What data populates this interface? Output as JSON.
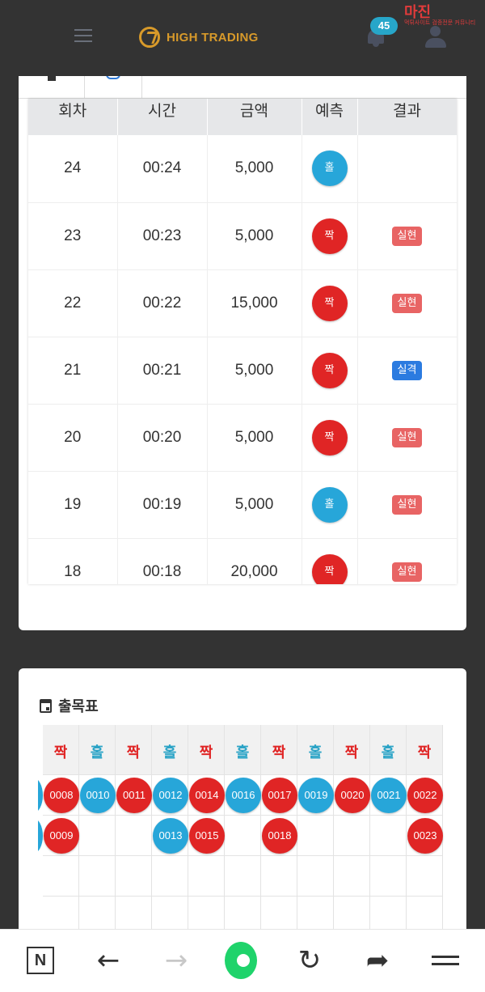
{
  "header": {
    "logo_text": "HIGH TRADING",
    "notification_count": "45",
    "watermark_main": "마진",
    "watermark_sub": "먹튀사이트 검증전문 커뮤니티"
  },
  "history_table": {
    "columns": [
      "회차",
      "시간",
      "금액",
      "예측",
      "결과"
    ],
    "rows": [
      {
        "round": "24",
        "time": "00:24",
        "amount": "5,000",
        "pick": "홀",
        "pick_type": "odd",
        "result": ""
      },
      {
        "round": "23",
        "time": "00:23",
        "amount": "5,000",
        "pick": "짝",
        "pick_type": "even",
        "result": "실현",
        "result_type": "hit"
      },
      {
        "round": "22",
        "time": "00:22",
        "amount": "15,000",
        "pick": "짝",
        "pick_type": "even",
        "result": "실현",
        "result_type": "hit"
      },
      {
        "round": "21",
        "time": "00:21",
        "amount": "5,000",
        "pick": "짝",
        "pick_type": "even",
        "result": "실격",
        "result_type": "miss"
      },
      {
        "round": "20",
        "time": "00:20",
        "amount": "5,000",
        "pick": "짝",
        "pick_type": "even",
        "result": "실현",
        "result_type": "hit"
      },
      {
        "round": "19",
        "time": "00:19",
        "amount": "5,000",
        "pick": "홀",
        "pick_type": "odd",
        "result": "실현",
        "result_type": "hit"
      },
      {
        "round": "18",
        "time": "00:18",
        "amount": "20,000",
        "pick": "짝",
        "pick_type": "even",
        "result": "실현",
        "result_type": "hit"
      }
    ]
  },
  "roadmap": {
    "title": "출목표",
    "columns": [
      {
        "head": "짝",
        "type": "even",
        "beads": [
          "0008",
          "0009"
        ]
      },
      {
        "head": "홀",
        "type": "odd",
        "beads": [
          "0010"
        ]
      },
      {
        "head": "짝",
        "type": "even",
        "beads": [
          "0011"
        ]
      },
      {
        "head": "홀",
        "type": "odd",
        "beads": [
          "0012",
          "0013"
        ]
      },
      {
        "head": "짝",
        "type": "even",
        "beads": [
          "0014",
          "0015"
        ]
      },
      {
        "head": "홀",
        "type": "odd",
        "beads": [
          "0016"
        ]
      },
      {
        "head": "짝",
        "type": "even",
        "beads": [
          "0017",
          "0018"
        ]
      },
      {
        "head": "홀",
        "type": "odd",
        "beads": [
          "0019"
        ]
      },
      {
        "head": "짝",
        "type": "even",
        "beads": [
          "0020"
        ]
      },
      {
        "head": "홀",
        "type": "odd",
        "beads": [
          "0021"
        ]
      },
      {
        "head": "짝",
        "type": "even",
        "beads": [
          "0022",
          "0023"
        ]
      }
    ]
  },
  "bottom_nav": {
    "n_label": "N",
    "back_glyph": "←",
    "forward_glyph": "→",
    "reload_glyph": "↻",
    "share_glyph": "➦"
  },
  "colors": {
    "odd": "#27a6d9",
    "even": "#e02525",
    "hit": "#e86464",
    "miss": "#2b7be0",
    "brand": "#d89a2a"
  }
}
